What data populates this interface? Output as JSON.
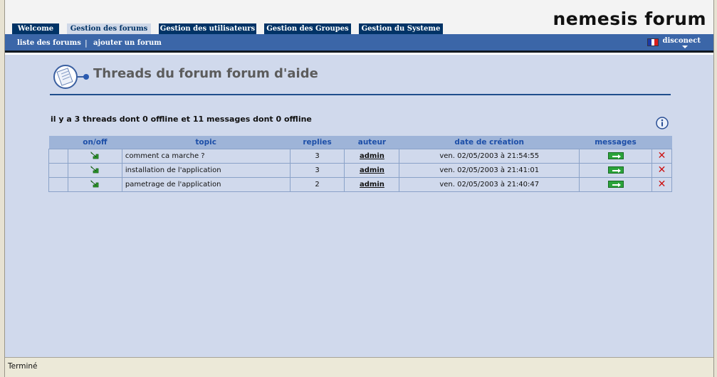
{
  "brand": {
    "logo": "nemesis forum"
  },
  "tabs": [
    {
      "label": "Welcome",
      "active": false
    },
    {
      "label": "Gestion des forums",
      "active": true
    },
    {
      "label": "Gestion des utilisateurs",
      "active": false
    },
    {
      "label": "Gestion des Groupes",
      "active": false
    },
    {
      "label": "Gestion du Systeme",
      "active": false
    }
  ],
  "subnav": {
    "links": [
      "liste des forums",
      "ajouter un forum"
    ],
    "separator": "|",
    "disconnect": "disconect"
  },
  "page": {
    "title": "Threads du forum forum d'aide",
    "summary": "il y a 3 threads dont 0 offline et 11 messages dont 0 offline"
  },
  "table": {
    "columns": [
      "on/off",
      "topic",
      "replies",
      "auteur",
      "date de création",
      "messages"
    ],
    "rows": [
      {
        "topic": "comment ca marche ?",
        "replies": "3",
        "author": "admin",
        "date": "ven. 02/05/2003 à 21:54:55"
      },
      {
        "topic": "installation de l'application",
        "replies": "3",
        "author": "admin",
        "date": "ven. 02/05/2003 à 21:41:01"
      },
      {
        "topic": "pametrage de l'application",
        "replies": "2",
        "author": "admin",
        "date": "ven. 02/05/2003 à 21:40:47"
      }
    ]
  },
  "statusbar": {
    "text": "Terminé"
  },
  "colors": {
    "tab": "#003366",
    "subnav": "#3b66a8",
    "content": "#d0d9ec",
    "table_header": "#9eb4d8",
    "header_text": "#1d4fa8"
  },
  "icons": {
    "header": "forum-document-icon",
    "info": "info-icon",
    "online": "green-arrow-icon",
    "messages": "go-arrow-icon",
    "delete": "delete-x-icon",
    "language": "french-flag-icon"
  }
}
